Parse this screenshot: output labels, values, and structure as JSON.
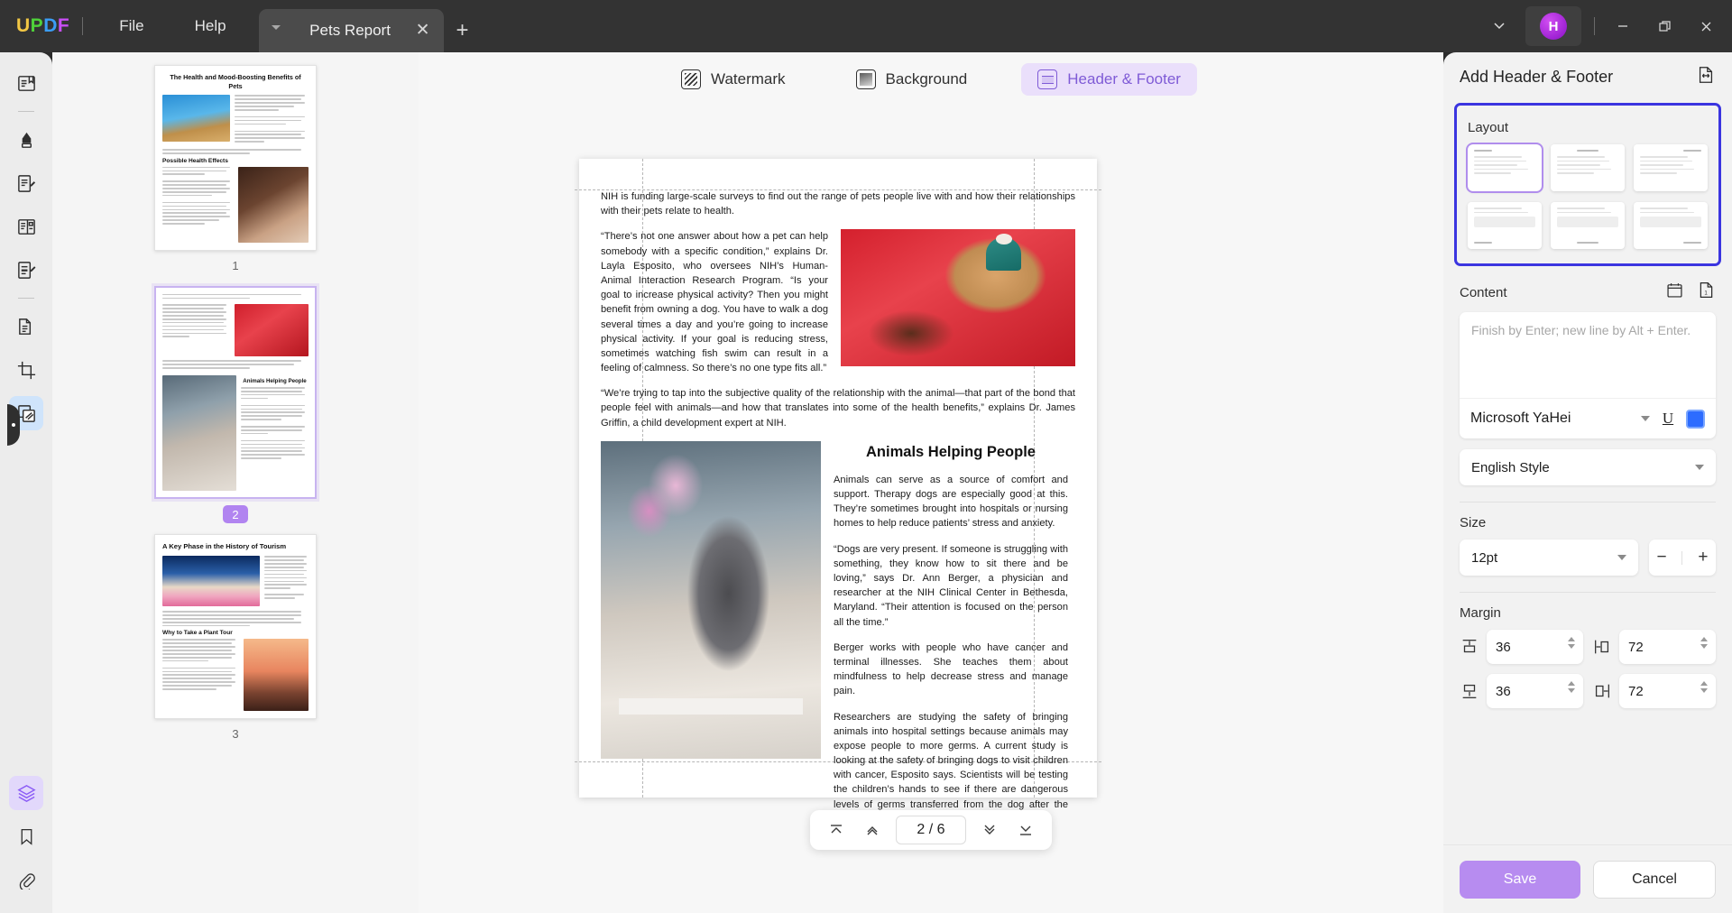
{
  "app": {
    "logo": [
      "U",
      "P",
      "D",
      "F"
    ],
    "menus": [
      {
        "label": "File",
        "name": "menu-file"
      },
      {
        "label": "Help",
        "name": "menu-help"
      }
    ],
    "tab": {
      "title": "Pets Report",
      "close_label": "✕",
      "new_tab_label": "+"
    },
    "window": {
      "avatar_initial": "H",
      "minimize_label": "—",
      "maximize_label": "❐",
      "close_label": "✕",
      "chevron_label": "⌄"
    }
  },
  "left_rail": {
    "items": [
      {
        "name": "rail-reader-icon",
        "title": "Reader"
      },
      {
        "name": "rail-highlight-icon",
        "title": "Highlight"
      },
      {
        "name": "rail-edit-icon",
        "title": "Edit PDF"
      },
      {
        "name": "rail-page-organize-icon",
        "title": "Organize Pages"
      },
      {
        "name": "rail-annotate-icon",
        "title": "Comment"
      },
      {
        "name": "rail-convert-icon",
        "title": "Convert"
      },
      {
        "name": "rail-crop-icon",
        "title": "Crop"
      },
      {
        "name": "rail-watermark-icon",
        "title": "Watermark & Background"
      },
      {
        "name": "rail-layers-icon",
        "title": "Layers"
      },
      {
        "name": "rail-bookmark-icon",
        "title": "Bookmark"
      },
      {
        "name": "rail-attachment-icon",
        "title": "Attachment"
      }
    ]
  },
  "thumbnails": {
    "pages": [
      {
        "number": "1",
        "selected": false,
        "title": "The Health and Mood-Boosting Benefits of Pets",
        "subheading": "Possible Health Effects"
      },
      {
        "number": "2",
        "selected": true,
        "title": "",
        "subheading": "Animals Helping People"
      },
      {
        "number": "3",
        "selected": false,
        "title": "A Key Phase in the History of Tourism",
        "subheading": "Why to Take a Plant Tour"
      }
    ]
  },
  "mode_bar": {
    "tabs": [
      {
        "label": "Watermark",
        "active": false,
        "icon": "watermark-icon"
      },
      {
        "label": "Background",
        "active": false,
        "icon": "background-icon"
      },
      {
        "label": "Header & Footer",
        "active": true,
        "icon": "header-footer-icon"
      }
    ]
  },
  "document": {
    "paragraphs": {
      "intro": "NIH is funding large-scale surveys to find out the range of pets people live with and how their relationships with their pets relate to health.",
      "quote1": "“There’s not one answer about how a pet can help somebody with a specific condition,” explains Dr. Layla Esposito, who oversees NIH’s Human-Animal Interaction Research Program. “Is your goal to increase physical activity? Then you might benefit from owning a dog. You have to walk a dog several times a day and you’re going to increase physical activity. If your goal is reducing stress, sometimes watching fish swim can result in a feeling of calmness. So there’s no one type fits all.”",
      "quote2": "“We’re trying to tap into the subjective quality of the relationship with the animal—that part of the bond that people feel with animals—and how that translates into some of the health benefits,” explains Dr. James Griffin, a child development expert at NIH.",
      "heading2": "Animals Helping People",
      "body1": "Animals can serve as a source of comfort and support. Therapy dogs are especially good at this. They’re sometimes brought into hospitals or nursing homes to help reduce patients’ stress and anxiety.",
      "body2": "“Dogs are very present. If someone is struggling with something, they know how to sit there and be loving,” says Dr. Ann Berger, a physician and researcher at the NIH Clinical Center in Bethesda, Maryland. “Their attention is focused on the person all the time.”",
      "body3": "Berger works with people who have cancer and terminal illnesses. She teaches them about mindfulness to help decrease stress and manage pain.",
      "body4": "Researchers are studying the safety of bringing animals into hospital settings because animals may expose people to more germs. A current study is looking at the safety of bringing dogs to visit children with cancer, Esposito says. Scientists will be testing the children’s hands to see if there are dangerous levels of germs transferred from the dog after the visit."
    },
    "images": {
      "dogs_red": "dogs-in-holiday-costumes-photo",
      "cat_tulips": "grey-cat-with-tulips-photo"
    }
  },
  "page_nav": {
    "first_label": "⤒",
    "prev_label": "⌃",
    "current": "2 / 6",
    "next_label": "⌄",
    "last_label": "⤓"
  },
  "right_panel": {
    "title": "Add Header & Footer",
    "expand_icon": "apply-to-page-icon",
    "layout": {
      "title": "Layout",
      "selected_index": 0,
      "options": [
        {
          "name": "layout-header-left",
          "position": "header",
          "align": "left"
        },
        {
          "name": "layout-header-center",
          "position": "header",
          "align": "center"
        },
        {
          "name": "layout-header-right",
          "position": "header",
          "align": "right"
        },
        {
          "name": "layout-footer-left",
          "position": "footer",
          "align": "left"
        },
        {
          "name": "layout-footer-center",
          "position": "footer",
          "align": "center"
        },
        {
          "name": "layout-footer-right",
          "position": "footer",
          "align": "right"
        }
      ]
    },
    "content": {
      "title": "Content",
      "date_icon": "calendar-icon",
      "page_number_icon": "page-number-icon",
      "textarea_placeholder": "Finish by Enter; new line by Alt + Enter.",
      "textarea_value": "",
      "font_family": "Microsoft YaHei",
      "underline_label": "U",
      "text_color": "#2d6cff",
      "style": "English Style"
    },
    "size": {
      "title": "Size",
      "value": "12pt",
      "decrease_label": "−",
      "increase_label": "+"
    },
    "margin": {
      "title": "Margin",
      "top": {
        "icon": "margin-top-icon",
        "value": "36"
      },
      "bottom": {
        "icon": "margin-bottom-icon",
        "value": "36"
      },
      "left": {
        "icon": "margin-left-icon",
        "value": "72"
      },
      "right": {
        "icon": "margin-right-icon",
        "value": "72"
      }
    },
    "footer": {
      "save_label": "Save",
      "cancel_label": "Cancel",
      "save_color": "#b78cf0"
    }
  }
}
